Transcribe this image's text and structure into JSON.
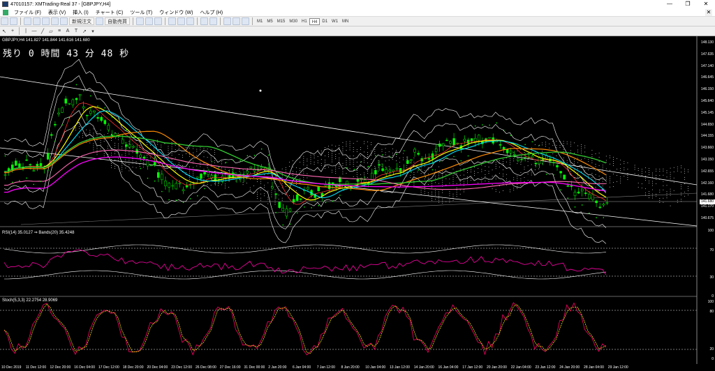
{
  "window": {
    "title": "47010157: XMTrading-Real 37 - [GBPJPY,H4]",
    "minimize": "—",
    "maximize": "❐",
    "close": "✕"
  },
  "menu": [
    "ファイル (F)",
    "表示 (V)",
    "挿入 (I)",
    "チャート (C)",
    "ツール (T)",
    "ウィンドウ (W)",
    "ヘルプ (H)"
  ],
  "toolbar": {
    "new_order": "新規注文",
    "auto_trading": "自動売買",
    "timeframes": [
      "M1",
      "M5",
      "M15",
      "M30",
      "H1",
      "H4",
      "D1",
      "W1",
      "MN"
    ],
    "active_timeframe": "H4"
  },
  "chart": {
    "symbol_header": "GBPJPY,H4  141.827 141.844 141.616 141.680",
    "countdown": "残り 0 時間 43 分 48 秒",
    "current_price": "141.680",
    "price_axis": [
      "148.130",
      "147.635",
      "147.140",
      "146.645",
      "146.150",
      "145.640",
      "145.145",
      "144.650",
      "144.155",
      "143.660",
      "143.150",
      "142.655",
      "142.160",
      "141.680",
      "141.170",
      "140.675"
    ],
    "rsi_label": "RSI(14) 35.0127  ⇒ Bands(20) 35.4248",
    "rsi_axis": [
      "100",
      "70",
      "30",
      "0"
    ],
    "stoch_label": "Stoch(5,3,3) 22.2754 28.9069",
    "stoch_axis": [
      "100",
      "80",
      "20",
      "0"
    ],
    "time_axis": [
      "10 Dec 2019",
      "11 Dec 12:00",
      "12 Dec 20:00",
      "16 Dec 04:00",
      "17 Dec 12:00",
      "18 Dec 20:00",
      "20 Dec 04:00",
      "23 Dec 12:00",
      "26 Dec 08:00",
      "27 Dec 16:00",
      "31 Dec 00:00",
      "2 Jan 20:00",
      "6 Jan 04:00",
      "7 Jan 12:00",
      "8 Jan 20:00",
      "10 Jan 04:00",
      "13 Jan 12:00",
      "14 Jan 20:00",
      "16 Jan 04:00",
      "17 Jan 12:00",
      "20 Jan 20:00",
      "22 Jan 04:00",
      "23 Jan 12:00",
      "24 Jan 20:00",
      "28 Jan 04:00",
      "29 Jan 12:00"
    ],
    "colors": {
      "background": "#000000",
      "bull_candle": "#00ff00",
      "bear_candle": "#00ff00",
      "ma_yellow": "#ffff00",
      "ma_cyan": "#00e5ff",
      "ma_orange": "#ff8c00",
      "ma_green": "#32cd32",
      "ma_magenta": "#ff00ff",
      "ma_red": "#ff3030",
      "ma_pink": "#ff69b4",
      "bands": "#ffffff",
      "ichimoku_cloud": "#ffffff",
      "rsi_line": "#ff00aa",
      "stoch_main": "#ff0066",
      "stoch_signal": "#ffff00"
    }
  }
}
